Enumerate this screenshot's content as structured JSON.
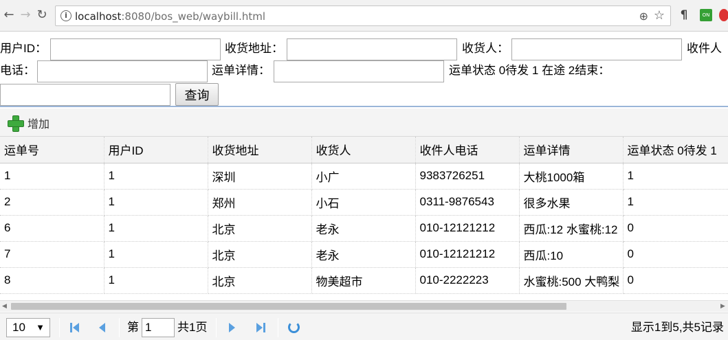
{
  "browser": {
    "url_host": "localhost",
    "url_rest": ":8080/bos_web/waybill.html"
  },
  "search_form": {
    "user_id_label": "用户ID：",
    "address_label": "收货地址：",
    "receiver_label": "收货人：",
    "phone_label_part1": "收件人",
    "phone_label_part2": "电话：",
    "detail_label": "运单详情：",
    "status_label": "运单状态 0待发 1 在途 2结束：",
    "query_button": "查询",
    "values": {
      "user_id": "",
      "address": "",
      "receiver": "",
      "phone": "",
      "detail": "",
      "status": ""
    }
  },
  "toolbar": {
    "add_label": "增加"
  },
  "table": {
    "columns": [
      "运单号",
      "用户ID",
      "收货地址",
      "收货人",
      "收件人电话",
      "运单详情",
      "运单状态 0待发 1"
    ],
    "rows": [
      [
        "1",
        "1",
        "深圳",
        "小广",
        "9383726251",
        "大桃1000箱",
        "1"
      ],
      [
        "2",
        "1",
        "郑州",
        "小石",
        "0311-9876543",
        "很多水果",
        "1"
      ],
      [
        "6",
        "1",
        "北京",
        "老永",
        "010-12121212",
        "西瓜:12 水蜜桃:12",
        "0"
      ],
      [
        "7",
        "1",
        "北京",
        "老永",
        "010-12121212",
        "西瓜:10",
        "0"
      ],
      [
        "8",
        "1",
        "北京",
        "物美超市",
        "010-2222223",
        "水蜜桃:500 大鸭梨",
        "0"
      ]
    ]
  },
  "pager": {
    "page_size": "10",
    "page_prefix": "第",
    "current_page": "1",
    "page_total": "共1页",
    "info": "显示1到5,共5记录"
  },
  "colors": {
    "accent": "#5aa0e0",
    "add_icon": "#3eaa3e",
    "form_border": "#9ab5d8"
  }
}
